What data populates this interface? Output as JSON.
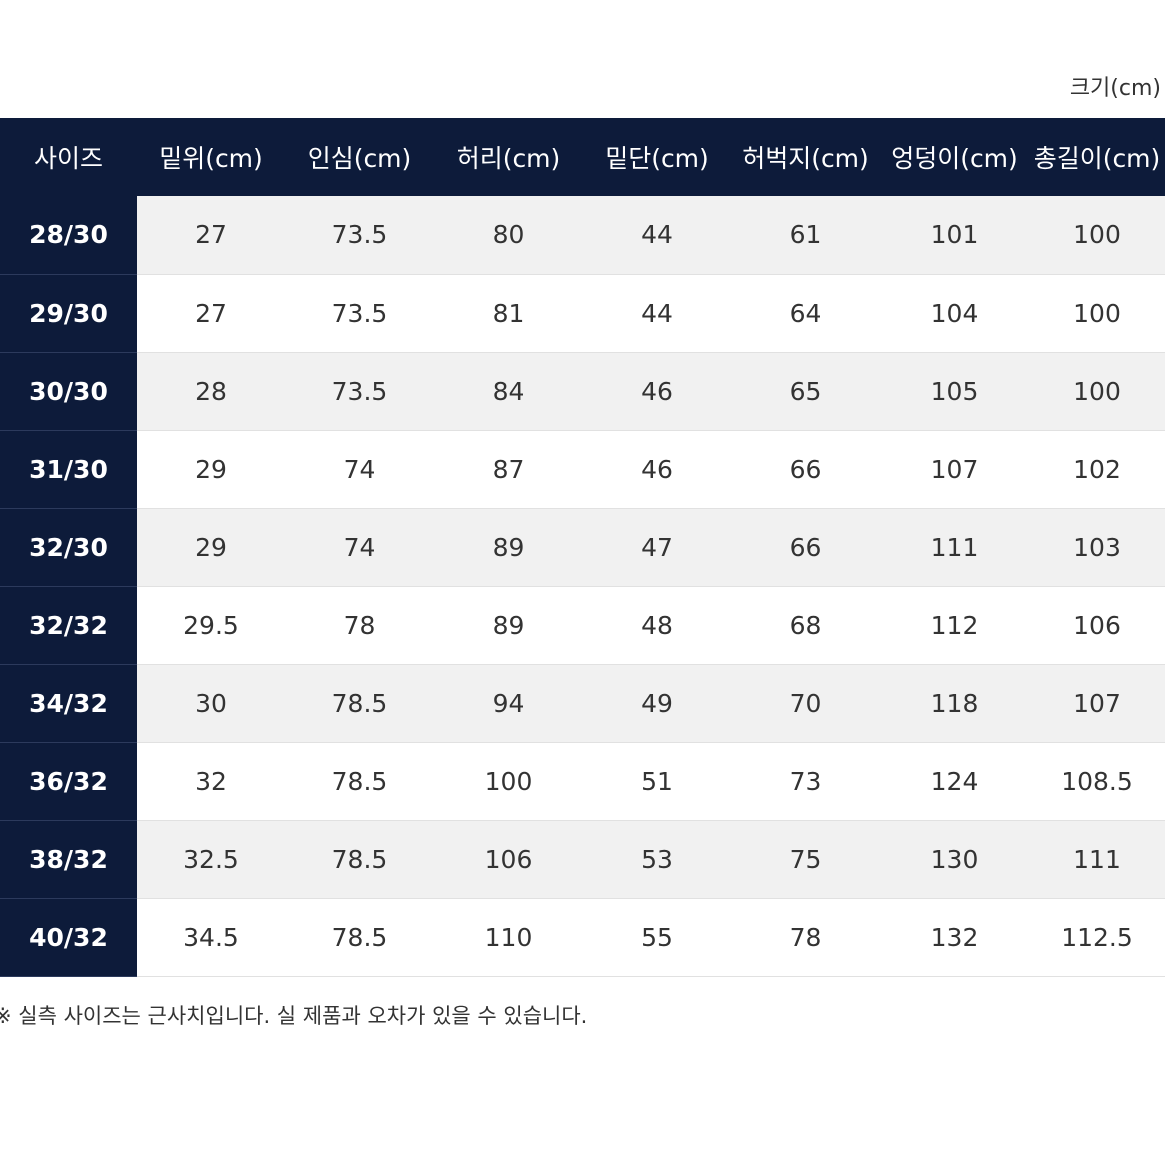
{
  "unit_note": "크기(cm)",
  "table": {
    "headers": [
      "사이즈",
      "밑위(cm)",
      "인심(cm)",
      "허리(cm)",
      "밑단(cm)",
      "허벅지(cm)",
      "엉덩이(cm)",
      "총길이(cm)"
    ],
    "rows": [
      [
        "28/30",
        "27",
        "73.5",
        "80",
        "44",
        "61",
        "101",
        "100"
      ],
      [
        "29/30",
        "27",
        "73.5",
        "81",
        "44",
        "64",
        "104",
        "100"
      ],
      [
        "30/30",
        "28",
        "73.5",
        "84",
        "46",
        "65",
        "105",
        "100"
      ],
      [
        "31/30",
        "29",
        "74",
        "87",
        "46",
        "66",
        "107",
        "102"
      ],
      [
        "32/30",
        "29",
        "74",
        "89",
        "47",
        "66",
        "111",
        "103"
      ],
      [
        "32/32",
        "29.5",
        "78",
        "89",
        "48",
        "68",
        "112",
        "106"
      ],
      [
        "34/32",
        "30",
        "78.5",
        "94",
        "49",
        "70",
        "118",
        "107"
      ],
      [
        "36/32",
        "32",
        "78.5",
        "100",
        "51",
        "73",
        "124",
        "108.5"
      ],
      [
        "38/32",
        "32.5",
        "78.5",
        "106",
        "53",
        "75",
        "130",
        "111"
      ],
      [
        "40/32",
        "34.5",
        "78.5",
        "110",
        "55",
        "78",
        "132",
        "112.5"
      ]
    ]
  },
  "footnote": "※ 실측 사이즈는 근사치입니다. 실 제품과 오차가 있을 수 있습니다.",
  "colors": {
    "header_bg": "#0d1b3a",
    "row_alt_bg": "#f1f1f1"
  }
}
